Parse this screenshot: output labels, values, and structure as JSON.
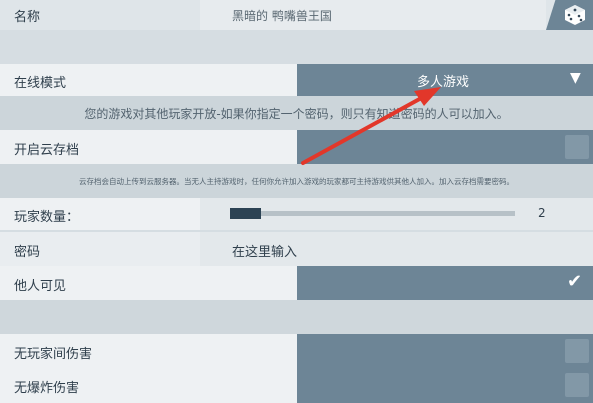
{
  "name_row": {
    "label": "名称",
    "value": "黑暗的 鸭嘴兽王国"
  },
  "dice_icon": "dice-icon",
  "online_mode": {
    "label": "在线模式",
    "value": "多人游戏",
    "chevron": "▼"
  },
  "online_desc": "您的游戏对其他玩家开放-如果你指定一个密码，则只有知道密码的人可以加入。",
  "cloud_save": {
    "label": "开启云存档",
    "checked": false
  },
  "cloud_desc": "云存档会自动上传到云服务器。当无人主持游戏时，任何你允许加入游戏的玩家都可主持游戏供其他人加入。加入云存档需要密码。",
  "player_count": {
    "label": "玩家数量：",
    "value": "2",
    "fraction": 0.11
  },
  "password": {
    "label": "密码",
    "placeholder": "在这里输入"
  },
  "visible": {
    "label": "他人可见",
    "checked": true,
    "check_glyph": "✔"
  },
  "no_pvp": {
    "label": "无玩家间伤害",
    "checked": false
  },
  "no_explosion": {
    "label": "无爆炸伤害",
    "checked": false
  },
  "colors": {
    "accent_dark": "#6d8596",
    "arrow_red": "#e2372a"
  }
}
